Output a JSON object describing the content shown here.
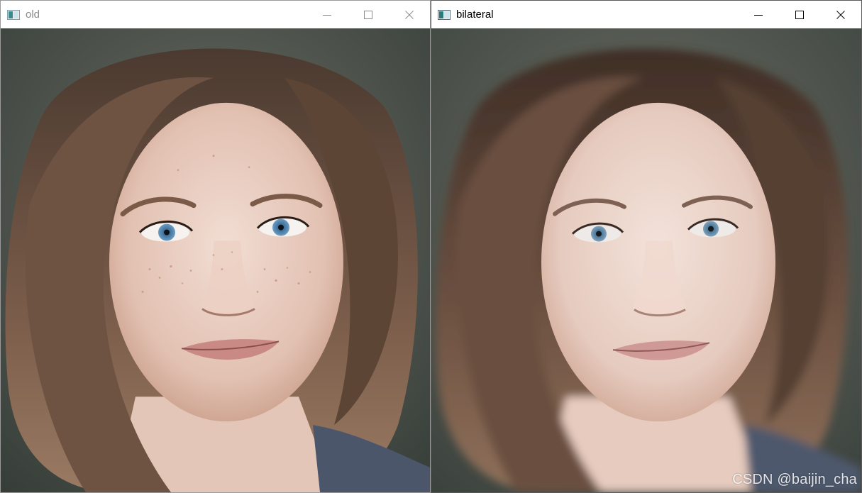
{
  "windows": [
    {
      "title": "old",
      "state": "inactive",
      "image": "portrait-original",
      "caption_buttons": [
        "minimize",
        "maximize",
        "close"
      ]
    },
    {
      "title": "bilateral",
      "state": "active",
      "image": "portrait-bilateral-filtered",
      "caption_buttons": [
        "minimize",
        "maximize",
        "close"
      ]
    }
  ],
  "watermark": "CSDN @baijin_cha",
  "colors": {
    "titlebar_bg": "#ffffff",
    "inactive_title": "#8a8a8a",
    "active_title": "#000000",
    "hair": "#5a4033",
    "skin": "#e6c9bd",
    "background": "#4a5248",
    "eyes": "#4f7ea8"
  }
}
